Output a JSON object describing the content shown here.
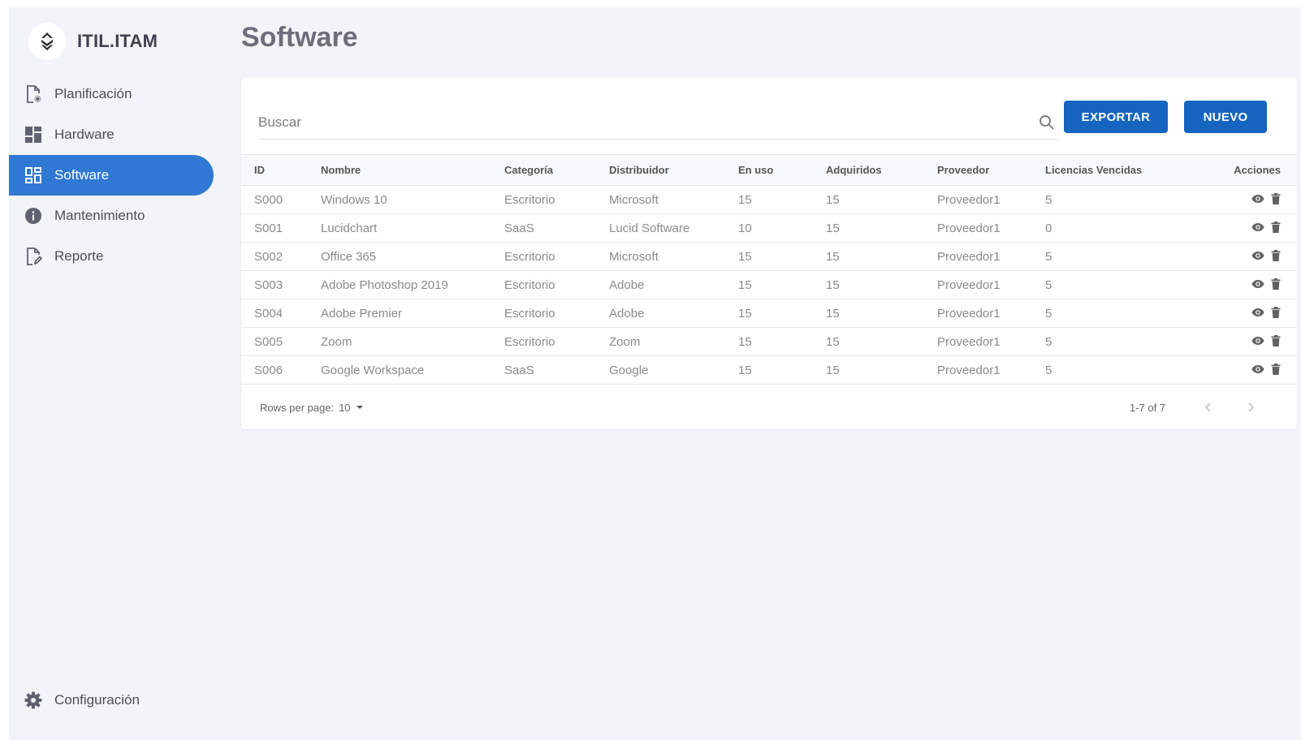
{
  "app": {
    "name": "ITIL.ITAM"
  },
  "sidebar": {
    "items": [
      {
        "label": "Planificación",
        "icon": "file-gear-icon"
      },
      {
        "label": "Hardware",
        "icon": "dashboard-icon"
      },
      {
        "label": "Software",
        "icon": "grid-icon",
        "active": true
      },
      {
        "label": "Mantenimiento",
        "icon": "info-icon"
      },
      {
        "label": "Reporte",
        "icon": "file-edit-icon"
      }
    ],
    "config_label": "Configuración"
  },
  "page": {
    "title": "Software"
  },
  "search": {
    "placeholder": "Buscar"
  },
  "buttons": {
    "export": "EXPORTAR",
    "new": "NUEVO"
  },
  "table": {
    "columns": [
      "ID",
      "Nombre",
      "Categoría",
      "Distribuidor",
      "En uso",
      "Adquiridos",
      "Proveedor",
      "Licencias Vencidas",
      "Acciones"
    ],
    "rows": [
      [
        "S000",
        "Windows 10",
        "Escritorio",
        "Microsoft",
        "15",
        "15",
        "Proveedor1",
        "5"
      ],
      [
        "S001",
        "Lucidchart",
        "SaaS",
        "Lucid Software",
        "10",
        "15",
        "Proveedor1",
        "0"
      ],
      [
        "S002",
        "Office 365",
        "Escritorio",
        "Microsoft",
        "15",
        "15",
        "Proveedor1",
        "5"
      ],
      [
        "S003",
        "Adobe Photoshop 2019",
        "Escritorio",
        "Adobe",
        "15",
        "15",
        "Proveedor1",
        "5"
      ],
      [
        "S004",
        "Adobe Premier",
        "Escritorio",
        "Adobe",
        "15",
        "15",
        "Proveedor1",
        "5"
      ],
      [
        "S005",
        "Zoom",
        "Escritorio",
        "Zoom",
        "15",
        "15",
        "Proveedor1",
        "5"
      ],
      [
        "S006",
        "Google Workspace",
        "SaaS",
        "Google",
        "15",
        "15",
        "Proveedor1",
        "5"
      ]
    ]
  },
  "pagination": {
    "rows_per_page_label": "Rows per page:",
    "rows_per_page": "10",
    "range": "1-7 of 7"
  },
  "colors": {
    "accent": "#2f78d4",
    "button": "#1565c0",
    "background": "#f3f4f9"
  }
}
